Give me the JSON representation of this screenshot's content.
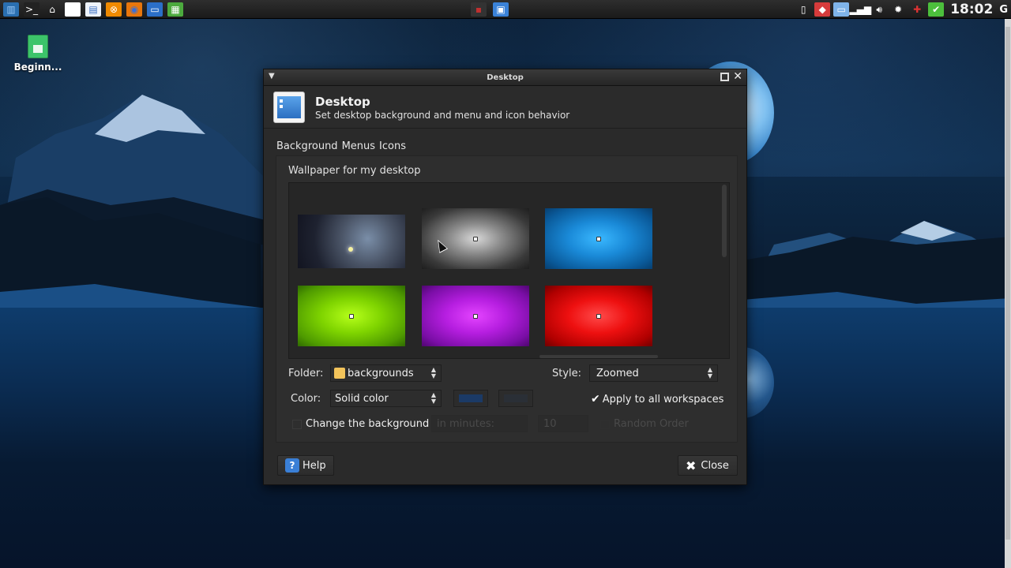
{
  "panel": {
    "launchers": [
      {
        "name": "app-menu-icon",
        "glyph": "▥",
        "bg": "#2a6fb0",
        "fg": "#9cc9f5"
      },
      {
        "name": "terminal-icon",
        "glyph": ">_",
        "bg": "#222222",
        "fg": "#ffffff"
      },
      {
        "name": "home-icon",
        "glyph": "⌂",
        "bg": "transparent",
        "fg": "#ffffff"
      },
      {
        "name": "file-icon",
        "glyph": "▯",
        "bg": "#ffffff",
        "fg": "#ffffff"
      },
      {
        "name": "document-icon",
        "glyph": "▤",
        "bg": "#eef3fb",
        "fg": "#3a6fc0"
      },
      {
        "name": "media-player-icon",
        "glyph": "⊗",
        "bg": "#f08a00",
        "fg": "#ffffff"
      },
      {
        "name": "firefox-icon",
        "glyph": "◉",
        "bg": "#e8760c",
        "fg": "#3a6fd8"
      },
      {
        "name": "monitor-icon",
        "glyph": "▭",
        "bg": "#2b6fc8",
        "fg": "#ffffff"
      },
      {
        "name": "video-editor-icon",
        "glyph": "▦",
        "bg": "#4caa3e",
        "fg": "#ffffff"
      }
    ],
    "taskbar": [
      {
        "name": "taskbar-app-icon",
        "glyph": "▪",
        "bg": "#333333",
        "fg": "#c03030"
      },
      {
        "name": "taskbar-desktop-settings-icon",
        "glyph": "▣",
        "bg": "#3a82d8",
        "fg": "#ffffff"
      }
    ],
    "tray": [
      {
        "name": "clipboard-icon",
        "glyph": "▯",
        "bg": "transparent",
        "fg": "#ffffff"
      },
      {
        "name": "tray-app-icon",
        "glyph": "◆",
        "bg": "#d63b3b",
        "fg": "#ffffff"
      },
      {
        "name": "display-icon",
        "glyph": "▭",
        "bg": "#7fb4ea",
        "fg": "#ffffff"
      },
      {
        "name": "signal-icon",
        "glyph": "▂▄▆",
        "bg": "transparent",
        "fg": "#ffffff"
      },
      {
        "name": "volume-icon",
        "glyph": "🔊︎",
        "bg": "transparent",
        "fg": "#ffffff"
      },
      {
        "name": "settings-icon",
        "glyph": "✹",
        "bg": "transparent",
        "fg": "#ffffff"
      },
      {
        "name": "network-icon",
        "glyph": "✚",
        "bg": "transparent",
        "fg": "#d33"
      },
      {
        "name": "chat-icon",
        "glyph": "✔",
        "bg": "#4cbf3c",
        "fg": "#ffffff"
      }
    ],
    "clock": "18:02",
    "power_glyph": "G"
  },
  "desktop_icon": {
    "label": "Beginn..."
  },
  "dialog": {
    "window_title": "Desktop",
    "header_title": "Desktop",
    "header_subtitle": "Set desktop background and menu and icon behavior",
    "tabs": [
      "Background",
      "Menus",
      "Icons"
    ],
    "wallpaper_label": "Wallpaper for my desktop",
    "thumbnails": [
      {
        "name": "wallpaper-nebula",
        "bg": "radial-gradient(circle at 65% 45%, #7a8ea8 0%, #4a5466 35%, #1e2230 70%, #121420 100%)",
        "dot": false
      },
      {
        "name": "wallpaper-gray",
        "bg": "radial-gradient(ellipse at center, #d8d8d8 0%, #8a8a8a 35%, #3a3a3a 75%, #1e1e1e 100%)",
        "dot": true
      },
      {
        "name": "wallpaper-blue",
        "bg": "radial-gradient(ellipse at center, #3ab8ff 0%, #1a8ad8 40%, #0a5a9a 80%, #073f70 100%)",
        "dot": true
      },
      {
        "name": "wallpaper-green",
        "bg": "radial-gradient(ellipse at center, #b6ff1a 0%, #7fd400 40%, #4e9a00 80%, #2f6a00 100%)",
        "dot": true
      },
      {
        "name": "wallpaper-purple",
        "bg": "radial-gradient(ellipse at center, #e444ff 0%, #b61ee0 40%, #7a0ea6 80%, #4f0670 100%)",
        "dot": true
      },
      {
        "name": "wallpaper-red",
        "bg": "radial-gradient(ellipse at center, #ff4a4a 0%, #ee1010 40%, #b00000 80%, #700000 100%)",
        "dot": true
      }
    ],
    "folder_label": "Folder:",
    "folder_value": "backgrounds",
    "style_label": "Style:",
    "style_value": "Zoomed",
    "color_label": "Color:",
    "color_value": "Solid color",
    "color1": "#1b3a66",
    "color2": "#2a2f36",
    "apply_all_label": "Apply to all workspaces",
    "apply_all_checked": true,
    "change_bg_label": "Change the background",
    "change_bg_checked": false,
    "interval_value": "in minutes:",
    "interval_number": "10",
    "random_order_label": "Random Order",
    "help_label": "Help",
    "close_label": "Close"
  }
}
